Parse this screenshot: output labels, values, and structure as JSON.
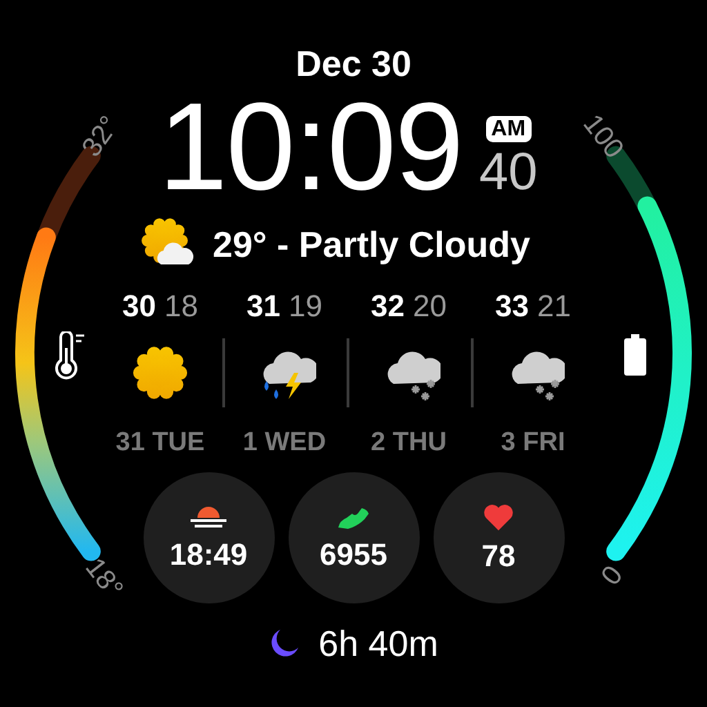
{
  "date": "Dec 30",
  "time": {
    "hours_minutes": "10:09",
    "ampm": "AM",
    "seconds": "40"
  },
  "current": {
    "kind": "partly_cloudy",
    "text": "29° - Partly Cloudy"
  },
  "forecast": [
    {
      "high": "30",
      "low": "18",
      "kind": "sunny",
      "day": "31 TUE"
    },
    {
      "high": "31",
      "low": "19",
      "kind": "thunder_rain",
      "day": "1 WED"
    },
    {
      "high": "32",
      "low": "20",
      "kind": "snow",
      "day": "2 THU"
    },
    {
      "high": "33",
      "low": "21",
      "kind": "snow",
      "day": "3 FRI"
    }
  ],
  "temperature_gauge": {
    "max_label": "32°",
    "min_label": "18°"
  },
  "battery_gauge": {
    "max_label": "100",
    "min_label": "0"
  },
  "complications": [
    {
      "kind": "sunset",
      "value": "18:49"
    },
    {
      "kind": "steps",
      "value": "6955"
    },
    {
      "kind": "heart_rate",
      "value": "78"
    }
  ],
  "sleep": {
    "value": "6h 40m"
  }
}
